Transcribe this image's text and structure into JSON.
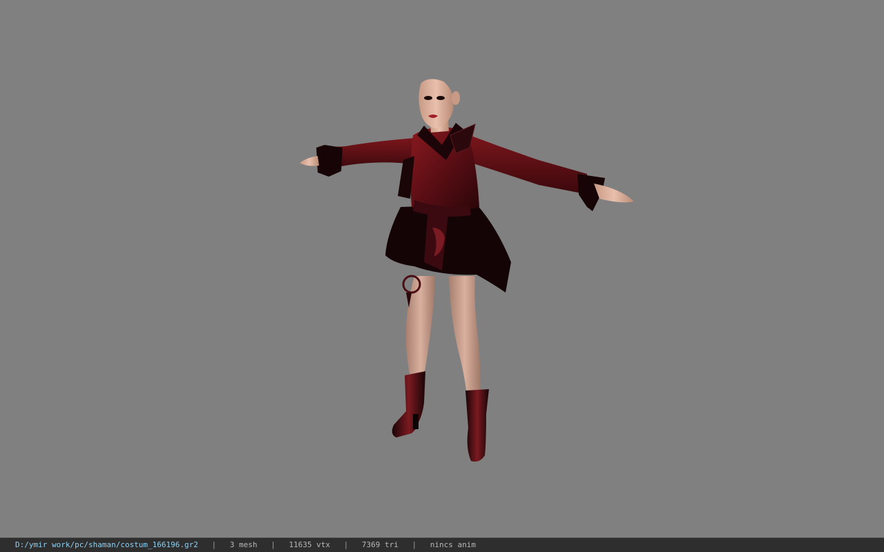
{
  "viewport": {
    "background_color": "#808080",
    "model": "character-model"
  },
  "status_bar": {
    "file_path": "D:/ymir work/pc/shaman/costum_166196.gr2",
    "separator": "|",
    "mesh_count": "3 mesh",
    "vertex_count": "11635 vtx",
    "triangle_count": "7369 tri",
    "animation_status": "nincs anim",
    "path_color": "#8fd0f0"
  },
  "colors": {
    "costume_red": "#6e1218",
    "costume_dark": "#1a0608",
    "skin": "#dcae98"
  }
}
